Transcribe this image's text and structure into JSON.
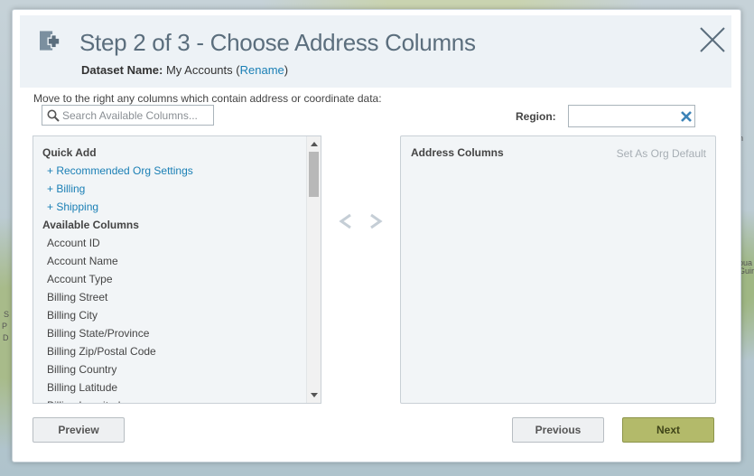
{
  "dialog": {
    "title": "Step 2 of 3 - Choose Address Columns",
    "dataset_label": "Dataset Name:",
    "dataset_name": "My Accounts",
    "rename_label": "Rename",
    "instruction": "Move to the right any columns which contain address or coordinate data:"
  },
  "search": {
    "placeholder": "Search Available Columns...",
    "value": ""
  },
  "region": {
    "label": "Region:",
    "value": ""
  },
  "left_list": {
    "quick_add_header": "Quick Add",
    "quick_add_items": [
      "+ Recommended Org Settings",
      "+ Billing",
      "+ Shipping"
    ],
    "available_header": "Available Columns",
    "columns": [
      "Account ID",
      "Account Name",
      "Account Type",
      "Billing Street",
      "Billing City",
      "Billing State/Province",
      "Billing Zip/Postal Code",
      "Billing Country",
      "Billing Latitude",
      "Billing Longitude"
    ]
  },
  "right_panel": {
    "title": "Address Columns",
    "set_default_label": "Set As Org Default"
  },
  "buttons": {
    "preview": "Preview",
    "previous": "Previous",
    "next": "Next"
  },
  "map_labels": [
    "n",
    "S",
    "P",
    "D",
    "pua",
    "Guir"
  ],
  "colors": {
    "accent": "#1a7fb5",
    "title": "#5b6e7d",
    "next_button": "#b3ba6a"
  }
}
